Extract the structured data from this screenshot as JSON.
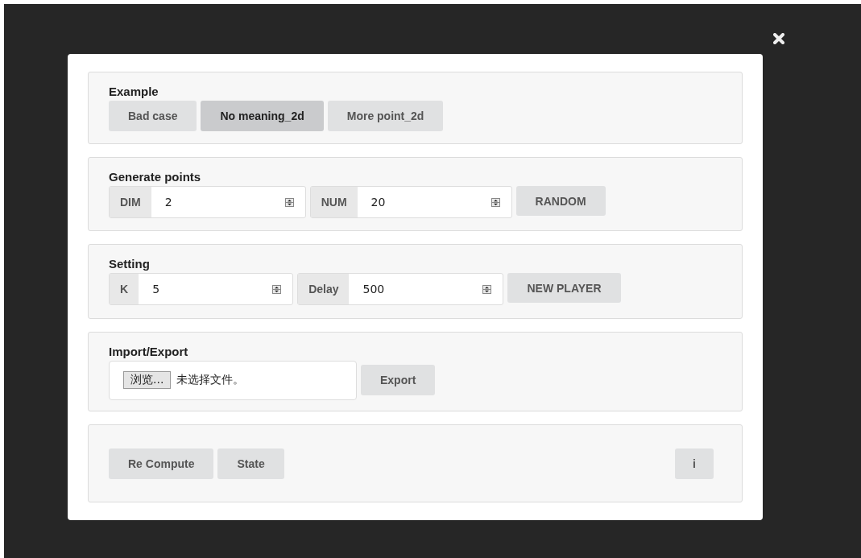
{
  "sections": [
    {
      "kind": "examples",
      "title": "Example",
      "buttons": [
        {
          "label": "Bad case",
          "selected": false
        },
        {
          "label": "No meaning_2d",
          "selected": true
        },
        {
          "label": "More point_2d",
          "selected": false
        }
      ]
    },
    {
      "kind": "inputs",
      "title": "Generate points",
      "fields": [
        {
          "label": "DIM",
          "value": "2"
        },
        {
          "label": "NUM",
          "value": "20"
        }
      ],
      "button": "RANDOM"
    },
    {
      "kind": "inputs",
      "title": "Setting",
      "fields": [
        {
          "label": "K",
          "value": "5"
        },
        {
          "label": "Delay",
          "value": "500"
        }
      ],
      "button": "NEW PLAYER"
    },
    {
      "kind": "file",
      "title": "Import/Export",
      "browse_label": "浏览...",
      "file_status": "未选择文件。",
      "button": "Export"
    },
    {
      "kind": "actions",
      "buttons": [
        "Re Compute",
        "State"
      ],
      "info_button": "i"
    }
  ]
}
